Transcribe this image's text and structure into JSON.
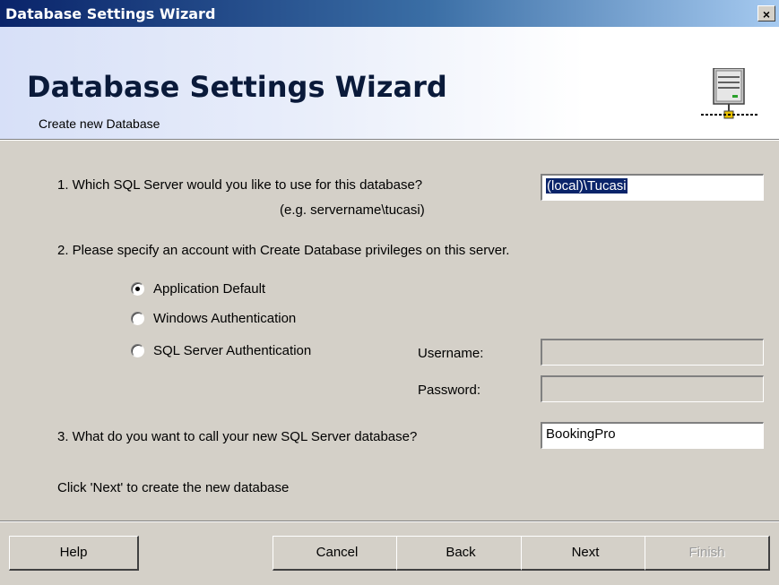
{
  "window": {
    "title": "Database Settings Wizard",
    "close_glyph": "×"
  },
  "banner": {
    "heading": "Database Settings Wizard",
    "subheading": "Create new Database",
    "icon": "database-server-icon"
  },
  "step1": {
    "question": "1. Which SQL Server would you like to use for this database?",
    "example": "(e.g. servername\\tucasi)",
    "server_value": "(local)\\Tucasi"
  },
  "step2": {
    "question": "2. Please specify an account with Create Database privileges on this server.",
    "options": [
      {
        "label": "Application Default",
        "selected": true
      },
      {
        "label": "Windows Authentication",
        "selected": false
      },
      {
        "label": "SQL Server Authentication",
        "selected": false
      }
    ],
    "username_label": "Username:",
    "password_label": "Password:",
    "username_value": "",
    "password_value": ""
  },
  "step3": {
    "question": "3. What do you want to call your new SQL Server database?",
    "database_name": "BookingPro"
  },
  "hint": "Click 'Next' to create the new database",
  "buttons": {
    "help": "Help",
    "cancel": "Cancel",
    "back": "Back",
    "next": "Next",
    "finish": "Finish",
    "finish_enabled": false
  },
  "colors": {
    "title_bar": "#0a246a",
    "face": "#d4d0c8",
    "selection": "#0a246a"
  }
}
